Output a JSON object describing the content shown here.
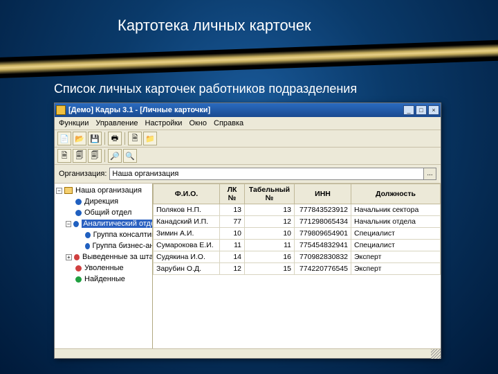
{
  "slide": {
    "title": "Картотека личных карточек",
    "subtitle": "Список личных карточек работников подразделения"
  },
  "window": {
    "title": "[Демо] Кадры 3.1 - [Личные карточки]",
    "controls": {
      "min": "_",
      "max": "□",
      "close": "×"
    }
  },
  "menu": [
    "Функции",
    "Управление",
    "Настройки",
    "Окно",
    "Справка"
  ],
  "org": {
    "label": "Организация:",
    "value": "Наша организация",
    "pick": "..."
  },
  "tree": {
    "root": "Наша организация",
    "items": [
      {
        "label": "Дирекция",
        "color": "#2060c0"
      },
      {
        "label": "Общий отдел",
        "color": "#2060c0"
      },
      {
        "label": "Аналитический отдел",
        "color": "#2060c0",
        "selected": true,
        "expanded": true
      },
      {
        "label": "Группа консалтинга",
        "color": "#2060c0",
        "indent": 3
      },
      {
        "label": "Группа бизнес-анализа",
        "color": "#2060c0",
        "indent": 3
      },
      {
        "label": "Выведенные за штат",
        "color": "#d04040",
        "top": true
      },
      {
        "label": "Уволенные",
        "color": "#d04040",
        "top": true
      },
      {
        "label": "Найденные",
        "color": "#20a040",
        "top": true
      }
    ]
  },
  "columns": [
    "Ф.И.О.",
    "ЛК №",
    "Табельный №",
    "ИНН",
    "Должность"
  ],
  "rows": [
    {
      "fio": "Поляков Н.П.",
      "lk": "13",
      "tab": "13",
      "inn": "777843523912",
      "pos": "Начальник сектора"
    },
    {
      "fio": "Канадский И.П.",
      "lk": "77",
      "tab": "12",
      "inn": "771298065434",
      "pos": "Начальник отдела"
    },
    {
      "fio": "Зимин А.И.",
      "lk": "10",
      "tab": "10",
      "inn": "779809654901",
      "pos": "Специалист"
    },
    {
      "fio": "Сумарокова Е.И.",
      "lk": "11",
      "tab": "11",
      "inn": "775454832941",
      "pos": "Специалист"
    },
    {
      "fio": "Судякина И.О.",
      "lk": "14",
      "tab": "16",
      "inn": "770982830832",
      "pos": "Эксперт"
    },
    {
      "fio": "Зарубин О.Д.",
      "lk": "12",
      "tab": "15",
      "inn": "774220776545",
      "pos": "Эксперт"
    }
  ],
  "icons": {
    "new": "📄",
    "open": "📂",
    "save": "💾",
    "print": "🖶",
    "doc": "🗎",
    "folder": "📁",
    "dup": "🗐",
    "find": "🔍",
    "bin": "🔎"
  }
}
